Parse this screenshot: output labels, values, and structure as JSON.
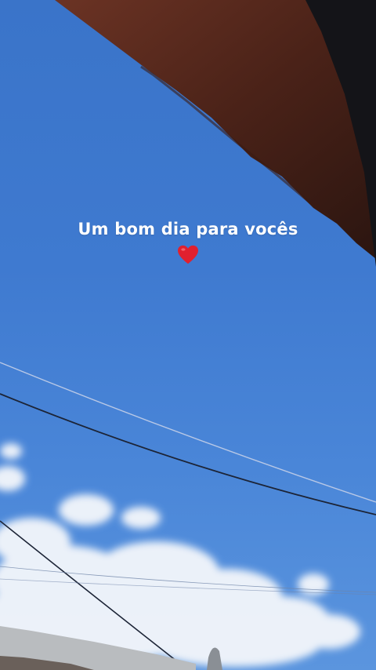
{
  "story": {
    "caption": "Um bom dia para vocês",
    "caption_emoji": "heart-icon",
    "colors": {
      "sky": "#3f7ad0",
      "roof": "#5a2a1c",
      "heart": "#e0202e",
      "text": "#ffffff"
    }
  }
}
